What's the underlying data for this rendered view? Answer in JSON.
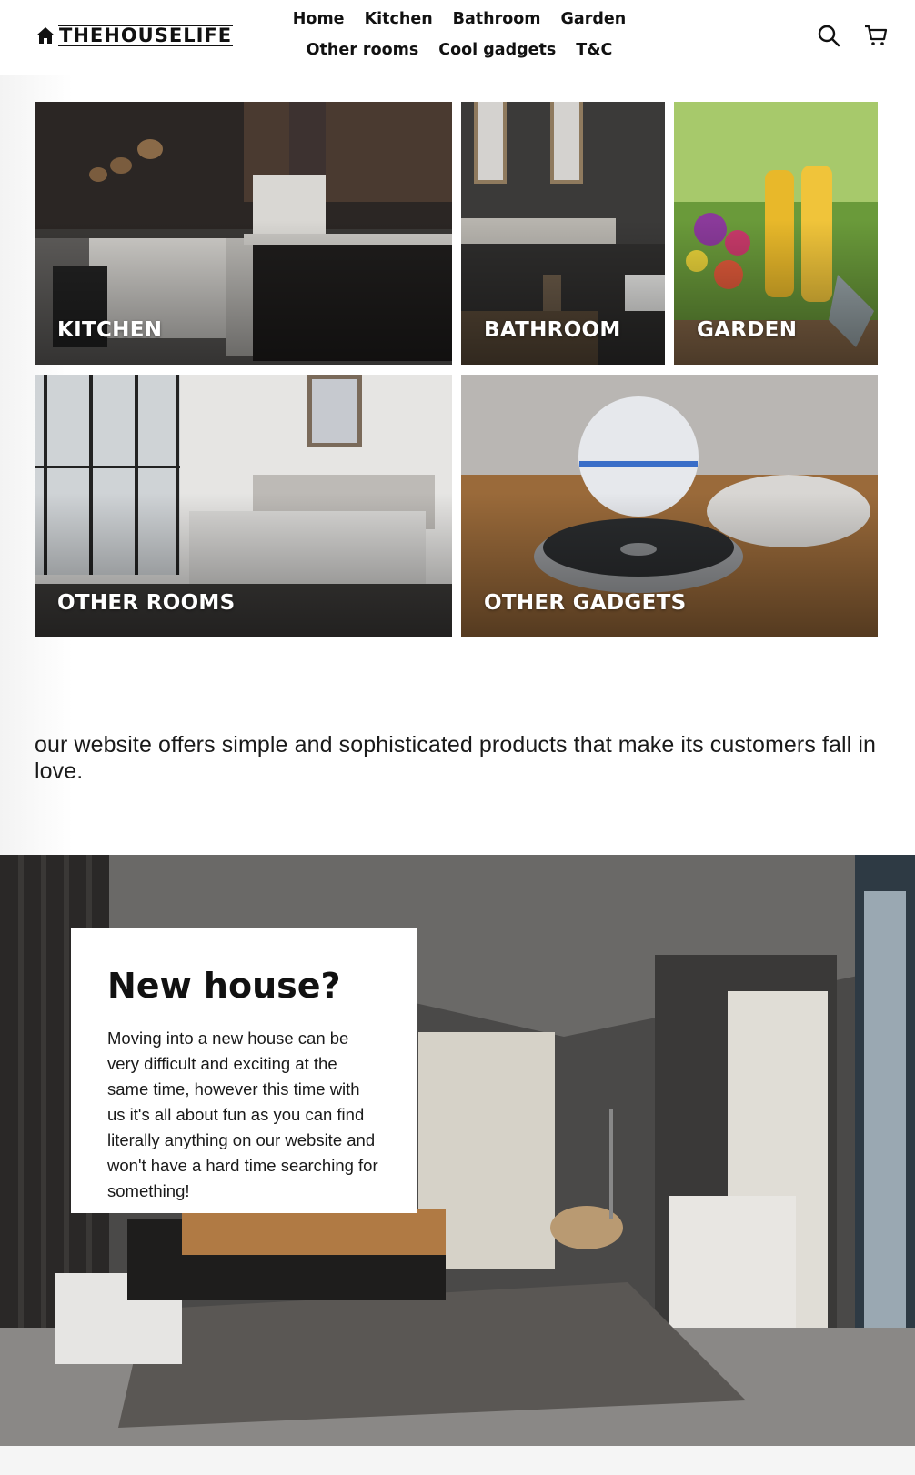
{
  "header": {
    "logo_text": "THEHOUSELIFE",
    "nav": [
      "Home",
      "Kitchen",
      "Bathroom",
      "Garden",
      "Other rooms",
      "Cool gadgets",
      "T&C"
    ],
    "icons": [
      "search-icon",
      "cart-icon"
    ]
  },
  "collections": [
    {
      "label": "KITCHEN"
    },
    {
      "label": "BATHROOM"
    },
    {
      "label": "GARDEN"
    },
    {
      "label": "OTHER ROOMS"
    },
    {
      "label": "OTHER GADGETS"
    }
  ],
  "tagline": "our website offers simple and sophisticated products that make its customers fall in love.",
  "hero": {
    "title": "New house?",
    "body": "Moving into a new house can be very difficult and exciting at the same time, however this time with us it's all about fun as you can find literally anything on our website and won't have a hard time searching for something!"
  },
  "colors": {
    "text": "#111111",
    "border": "#e6e6e6",
    "overlay_text": "#ffffff"
  }
}
